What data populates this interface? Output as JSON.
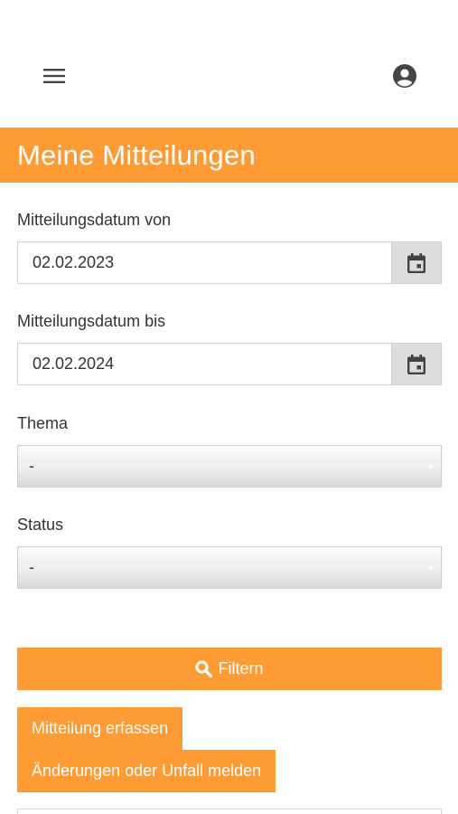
{
  "header": {
    "menu_icon": "hamburger-menu-icon",
    "account_icon": "account-circle-icon"
  },
  "page": {
    "title": "Meine Mitteilungen"
  },
  "filters": {
    "date_from": {
      "label": "Mitteilungsdatum von",
      "value": "02.02.2023",
      "icon": "calendar-icon"
    },
    "date_to": {
      "label": "Mitteilungsdatum bis",
      "value": "02.02.2024",
      "icon": "calendar-icon"
    },
    "topic": {
      "label": "Thema",
      "selected": "-"
    },
    "status": {
      "label": "Status",
      "selected": "-"
    },
    "filter_button": {
      "label": "Filtern",
      "icon": "search-icon"
    }
  },
  "actions": {
    "create_label": "Mitteilung erfassen",
    "report_label": "Änderungen oder Unfall melden"
  },
  "colors": {
    "accent": "#ff9b35",
    "text": "#333333",
    "calendar_button_bg": "#dcdcdc"
  }
}
